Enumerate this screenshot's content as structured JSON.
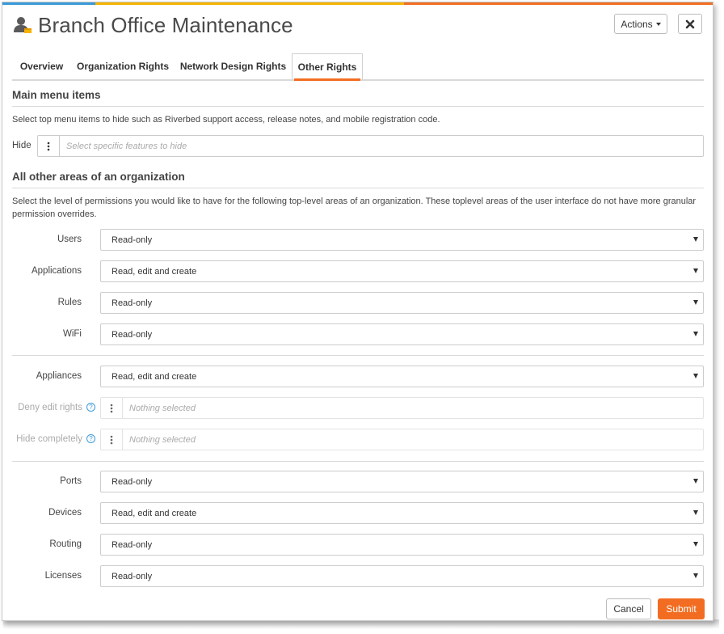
{
  "colors": {
    "accent": "#f26d21",
    "help_icon": "#3a9ad9",
    "topbar": [
      "#3a9ad9",
      "#f5b300",
      "#f26d21"
    ]
  },
  "header": {
    "title": "Branch Office Maintenance",
    "icon": "user-icon",
    "actions_label": "Actions",
    "close_icon": "close-icon"
  },
  "tabs": [
    {
      "label": "Overview"
    },
    {
      "label": "Organization Rights"
    },
    {
      "label": "Network Design Rights"
    },
    {
      "label": "Other Rights"
    }
  ],
  "active_tab": "Other Rights",
  "main_menu": {
    "title": "Main menu items",
    "description": "Select top menu items to hide such as Riverbed support access, release notes, and mobile registration code.",
    "hide_label": "Hide",
    "hide_placeholder": "Select specific features to hide"
  },
  "other_areas": {
    "title": "All other areas of an organization",
    "description": "Select the level of permissions you would like to have for the following top-level areas of an organization. These toplevel areas of the user interface do not have more granular permission overrides.",
    "group1": [
      {
        "label": "Users",
        "value": "Read-only"
      },
      {
        "label": "Applications",
        "value": "Read, edit and create"
      },
      {
        "label": "Rules",
        "value": "Read-only"
      },
      {
        "label": "WiFi",
        "value": "Read-only"
      }
    ],
    "appliances": {
      "label": "Appliances",
      "value": "Read, edit and create",
      "deny_label": "Deny edit rights",
      "deny_placeholder": "Nothing selected",
      "hide_label": "Hide completely",
      "hide_placeholder": "Nothing selected",
      "help_glyph": "?"
    },
    "group2": [
      {
        "label": "Ports",
        "value": "Read-only"
      },
      {
        "label": "Devices",
        "value": "Read, edit and create"
      },
      {
        "label": "Routing",
        "value": "Read-only"
      },
      {
        "label": "Licenses",
        "value": "Read-only"
      }
    ]
  },
  "footer": {
    "cancel_label": "Cancel",
    "submit_label": "Submit"
  }
}
